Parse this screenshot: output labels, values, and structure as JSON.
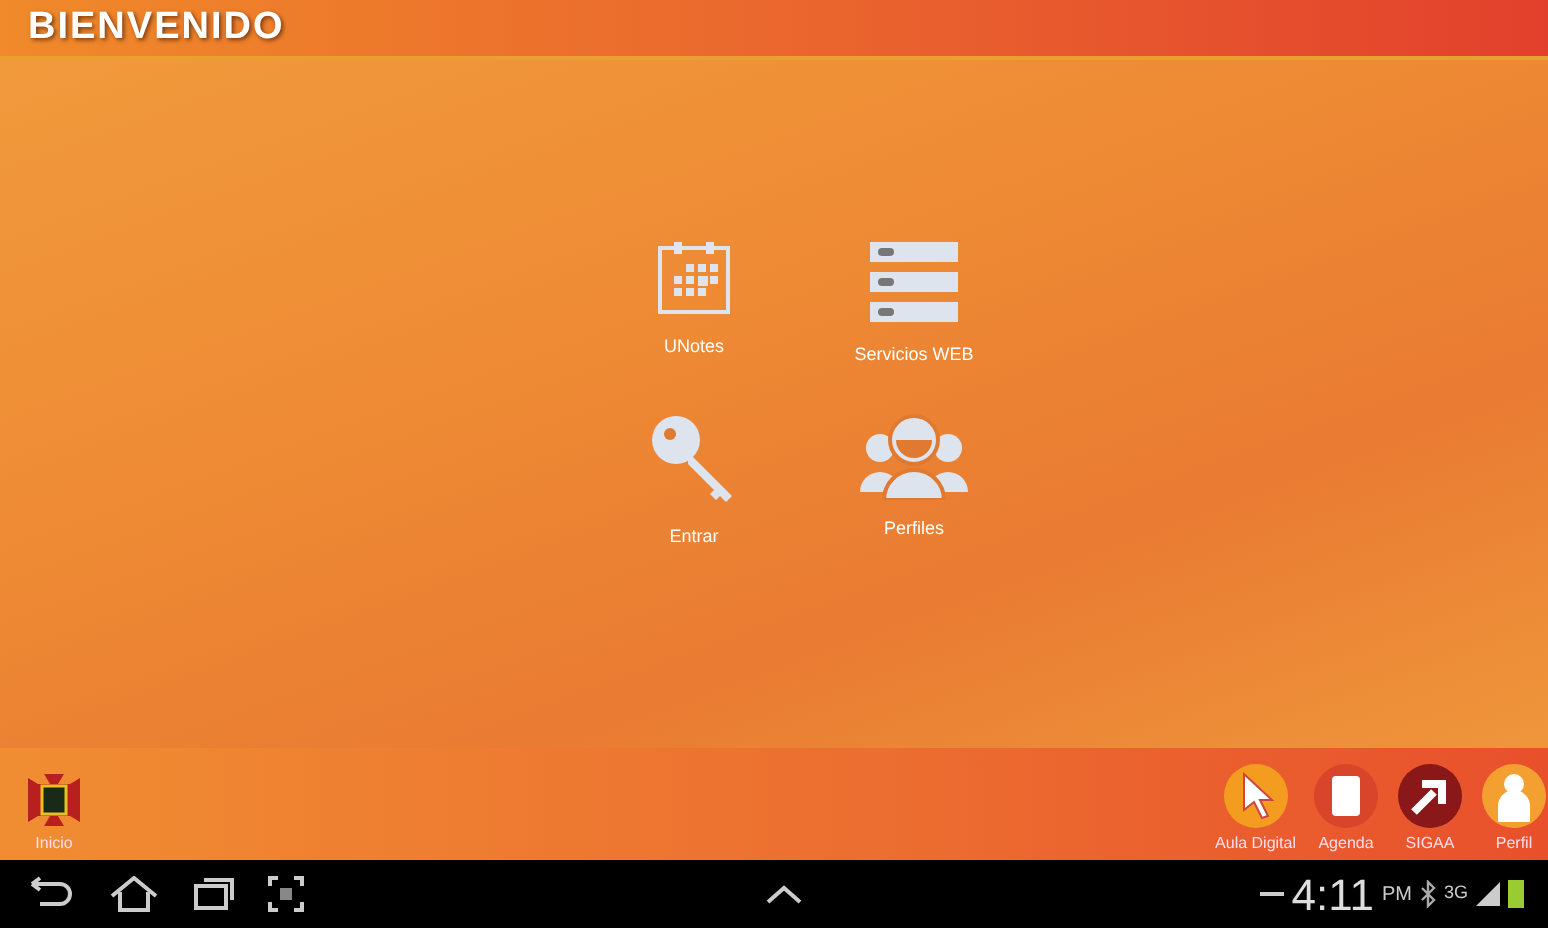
{
  "title_bar": {
    "title": "BIENVENIDO"
  },
  "apps": [
    {
      "kind": "calendar",
      "label": "UNotes"
    },
    {
      "kind": "servers",
      "label": "Servicios WEB"
    },
    {
      "kind": "key",
      "label": "Entrar"
    },
    {
      "kind": "people",
      "label": "Perfiles"
    }
  ],
  "dock": {
    "left": [
      {
        "kind": "crest",
        "label": "Inicio"
      }
    ],
    "right": [
      {
        "kind": "cursor",
        "label": "Aula Digital"
      },
      {
        "kind": "book",
        "label": "Agenda"
      },
      {
        "kind": "arrow",
        "label": "SIGAA"
      },
      {
        "kind": "person",
        "label": "Perfil"
      }
    ]
  },
  "system_bar": {
    "time": "4:11",
    "ampm": "PM",
    "network": "3G"
  }
}
